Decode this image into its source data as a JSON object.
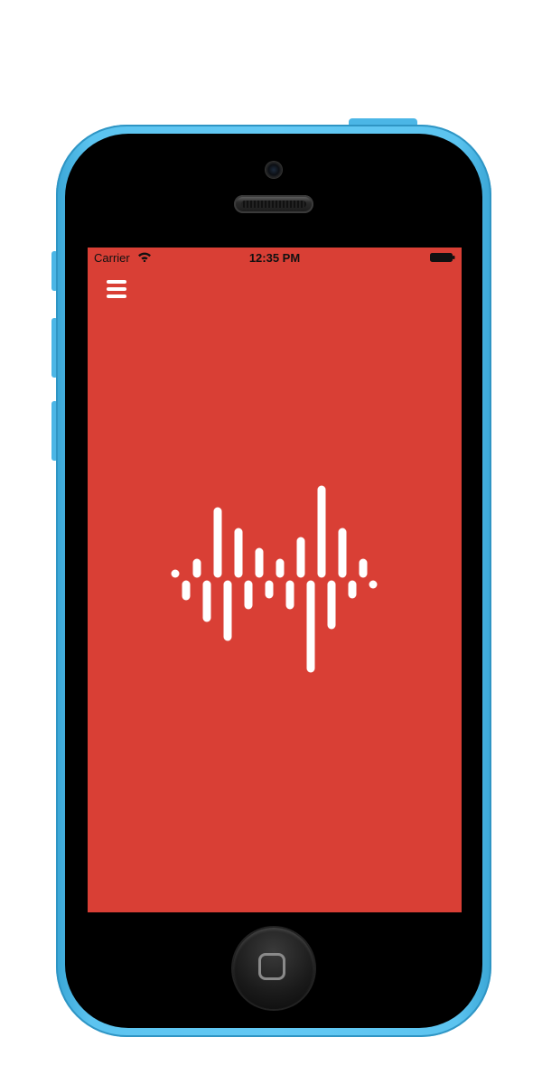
{
  "status_bar": {
    "carrier": "Carrier",
    "time": "12:35 PM",
    "wifi_icon": "wifi-icon",
    "battery_icon": "battery-icon"
  },
  "nav": {
    "menu_icon": "hamburger-menu-icon"
  },
  "logo": {
    "icon": "sound-wave-icon",
    "color": "#ffffff"
  },
  "colors": {
    "background": "#d93f35",
    "device_shell": "#5cc4f0",
    "device_face": "#000000"
  }
}
